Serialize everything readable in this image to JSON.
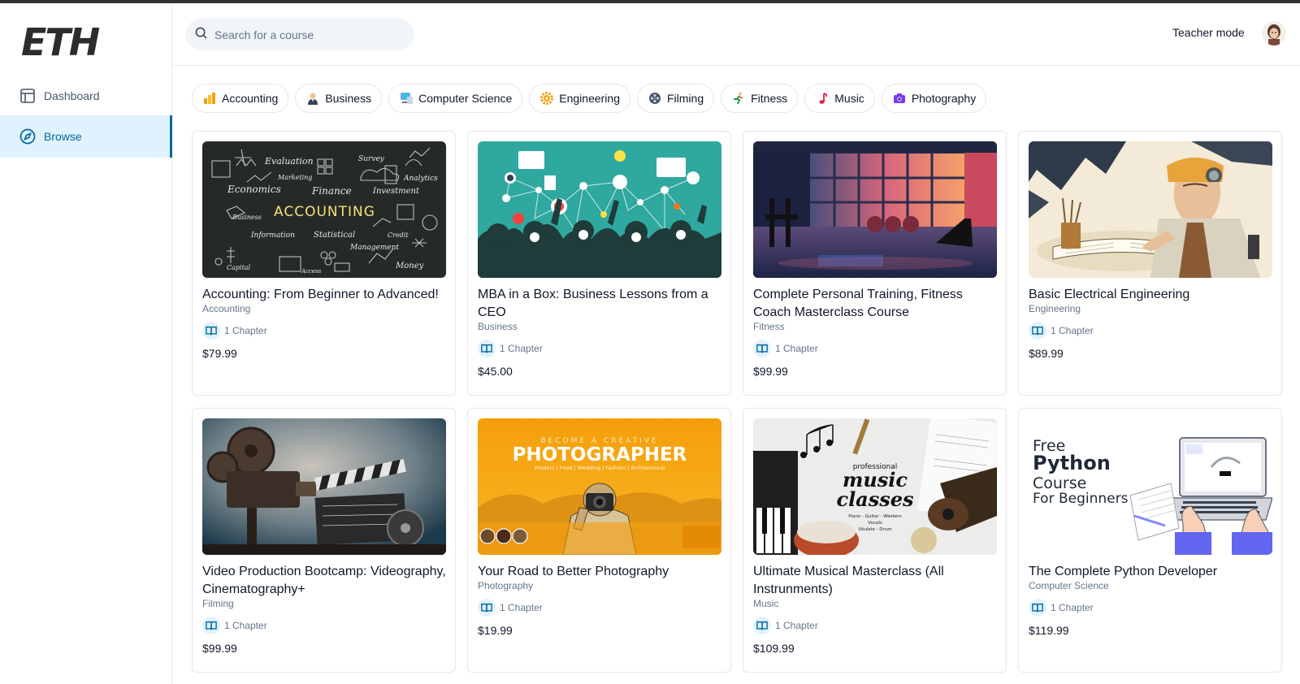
{
  "app": {
    "logo_text": "ETH"
  },
  "sidebar": {
    "items": [
      {
        "label": "Dashboard",
        "icon": "layout-icon",
        "active": false
      },
      {
        "label": "Browse",
        "icon": "compass-icon",
        "active": true
      }
    ]
  },
  "header": {
    "search_placeholder": "Search for a course",
    "teacher_mode_label": "Teacher mode"
  },
  "categories": [
    {
      "label": "Accounting",
      "icon": "bar-chart-emoji"
    },
    {
      "label": "Business",
      "icon": "businessperson-emoji"
    },
    {
      "label": "Computer Science",
      "icon": "computer-emoji"
    },
    {
      "label": "Engineering",
      "icon": "gear-emoji"
    },
    {
      "label": "Filming",
      "icon": "film-reel-emoji"
    },
    {
      "label": "Fitness",
      "icon": "runner-emoji"
    },
    {
      "label": "Music",
      "icon": "music-note-emoji"
    },
    {
      "label": "Photography",
      "icon": "camera-emoji"
    }
  ],
  "courses": [
    {
      "title": "Accounting: From Beginner to Advanced!",
      "category": "Accounting",
      "chapters": "1 Chapter",
      "price": "$79.99",
      "image_text": {
        "main": "ACCOUNTING",
        "words": [
          "Evaluation",
          "Survey",
          "Marketing",
          "Analytics",
          "Economics",
          "Finance",
          "Investment",
          "Business",
          "Information",
          "Statistical",
          "Credit",
          "Management",
          "Capital",
          "Access",
          "Money"
        ]
      }
    },
    {
      "title": "MBA in a Box: Business Lessons from a CEO",
      "category": "Business",
      "chapters": "1 Chapter",
      "price": "$45.00"
    },
    {
      "title": "Complete Personal Training, Fitness Coach Masterclass Course",
      "category": "Fitness",
      "chapters": "1 Chapter",
      "price": "$99.99"
    },
    {
      "title": "Basic Electrical Engineering",
      "category": "Engineering",
      "chapters": "1 Chapter",
      "price": "$89.99"
    },
    {
      "title": "Video Production Bootcamp: Videography, Cinematography+",
      "category": "Filming",
      "chapters": "1 Chapter",
      "price": "$99.99"
    },
    {
      "title": "Your Road to Better Photography",
      "category": "Photography",
      "chapters": "1 Chapter",
      "price": "$19.99",
      "image_text": {
        "top": "BECOME A CREATIVE",
        "main": "PHOTOGRAPHER",
        "sub": "Product | Food | Wedding | Fashion | Architectural"
      }
    },
    {
      "title": "Ultimate Musical Masterclass (All Instrunments)",
      "category": "Music",
      "chapters": "1 Chapter",
      "price": "$109.99",
      "image_text": {
        "top": "professional",
        "main1": "music",
        "main2": "classes",
        "sub1": "Piano - Guitar - Western",
        "sub2": "Vocals",
        "sub3": "Ukulele - Drum"
      }
    },
    {
      "title": "The Complete Python Developer",
      "category": "Computer Science",
      "chapters": "1 Chapter",
      "price": "$119.99",
      "image_text": {
        "l1": "Free",
        "l2": "Python",
        "l3": "Course",
        "l4": "For Beginners"
      }
    }
  ]
}
